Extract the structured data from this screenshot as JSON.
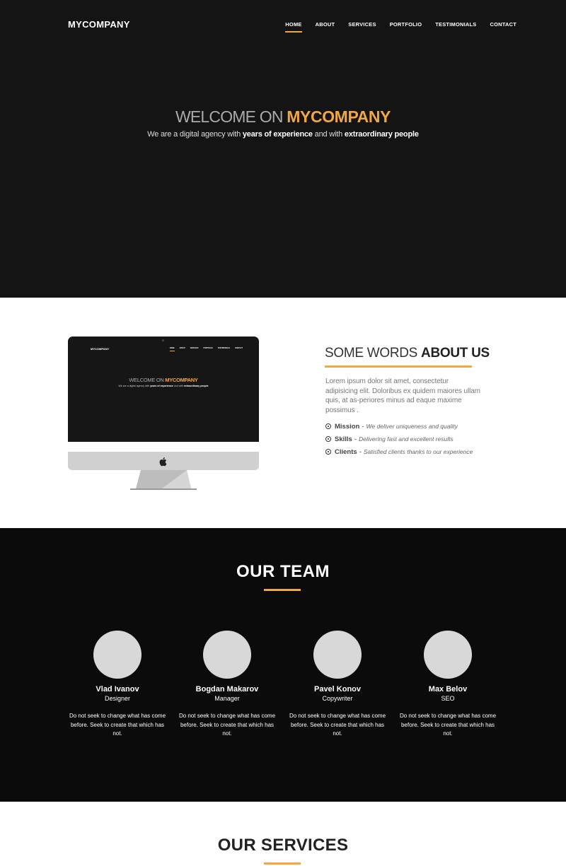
{
  "header": {
    "brand": "MYCOMPANY",
    "nav": [
      "HOME",
      "ABOUT",
      "SERVICES",
      "PORTFOLIO",
      "TESTIMONIALS",
      "CONTACT"
    ],
    "active_index": 0
  },
  "hero": {
    "title_prefix": "WELCOME ON ",
    "title_accent": "MYCOMPANY",
    "subtitle_1": "We are a digital agency with ",
    "subtitle_bold_1": "years of experience",
    "subtitle_2": " and with ",
    "subtitle_bold_2": "extraordinary people"
  },
  "about": {
    "title_light": "SOME WORDS ",
    "title_bold": "ABOUT US",
    "text": "Lorem ipsum dolor sit amet, consectetur adipisicing elit. Doloribus ex quidem maiores ullam quis, at as-periores minus ad eaque maxime possimus .",
    "items": [
      {
        "label": "Mission",
        "desc": "We deliver uniqueness and quality"
      },
      {
        "label": "Skills",
        "desc": "Delivering fast and excellent results"
      },
      {
        "label": "Clients",
        "desc": "Satisfied clients thanks to our experience"
      }
    ],
    "separator": "-"
  },
  "team": {
    "title": "OUR TEAM",
    "members": [
      {
        "name": "Vlad Ivanov",
        "role": "Designer",
        "desc": "Do not seek to change what has come before. Seek to create that which has not."
      },
      {
        "name": "Bogdan Makarov",
        "role": "Manager",
        "desc": "Do not seek to change what has come before. Seek to create that which has not."
      },
      {
        "name": "Pavel Konov",
        "role": "Copywriter",
        "desc": "Do not seek to change what has come before. Seek to create that which has not."
      },
      {
        "name": "Max Belov",
        "role": "SEO",
        "desc": "Do not seek to change what has come before. Seek to create that which has not."
      }
    ]
  },
  "services": {
    "title": "OUR SERVICES"
  },
  "colors": {
    "accent": "#f3a73f",
    "hero_bg": "#141414",
    "team_bg": "#0b0b0b"
  },
  "icons": {
    "list_bullet": "check-circle-icon",
    "monitor_logo": "apple-icon"
  }
}
